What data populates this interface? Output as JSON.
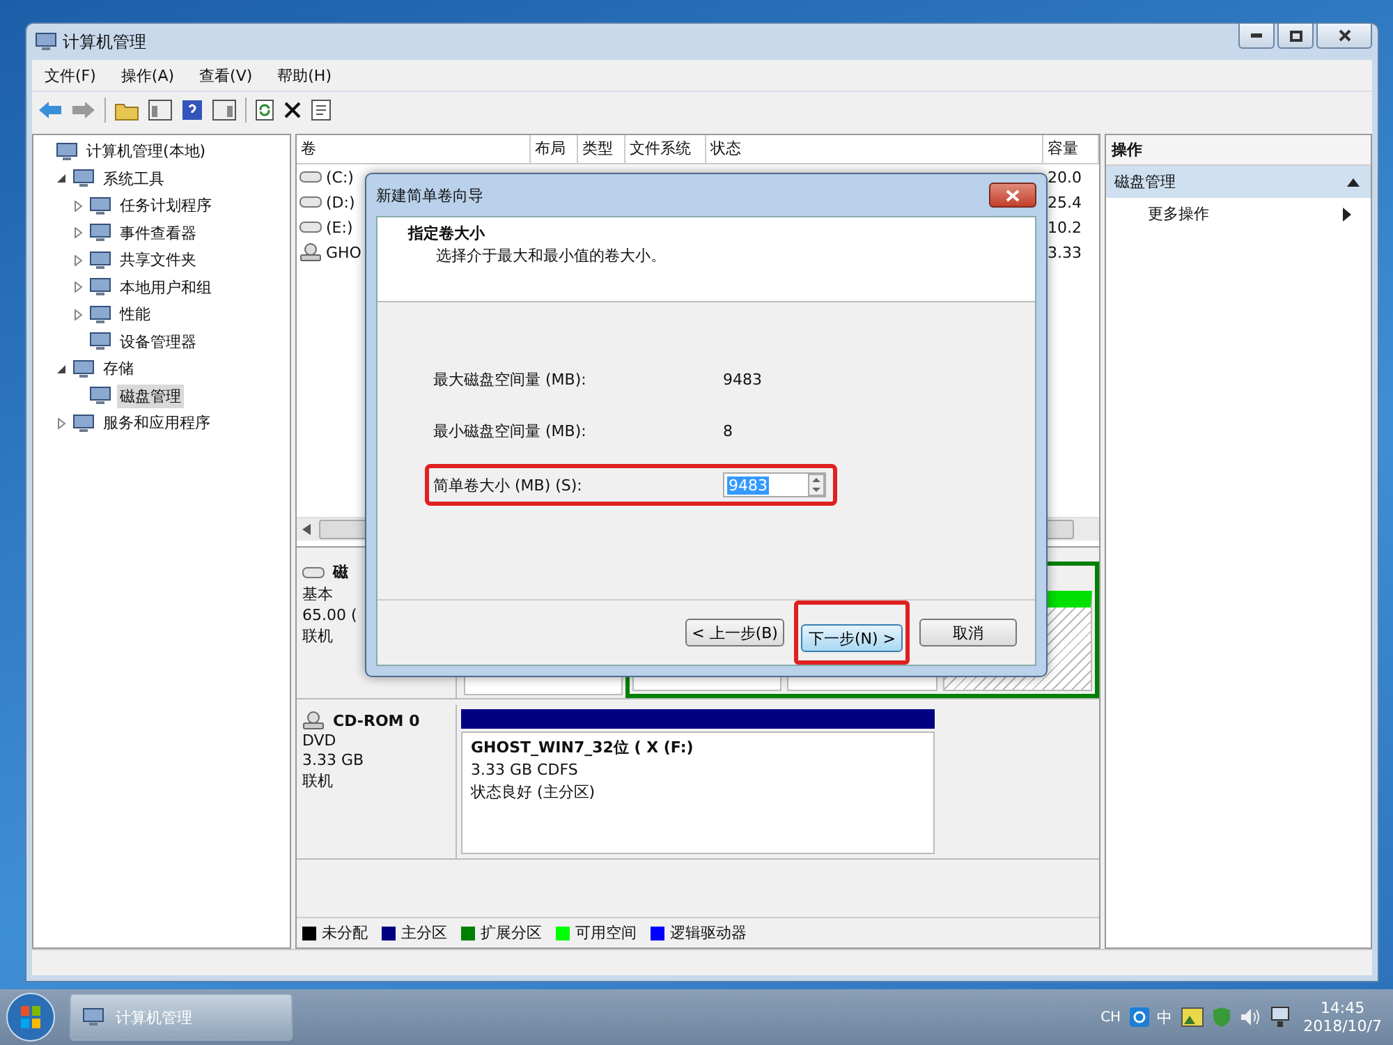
{
  "window": {
    "title": "计算机管理"
  },
  "menu": [
    "文件(F)",
    "操作(A)",
    "查看(V)",
    "帮助(H)"
  ],
  "tree": [
    {
      "label": "计算机管理(本地)",
      "selected": false,
      "children": [
        {
          "label": "系统工具",
          "kind": "branch",
          "expanded": true,
          "selected": false,
          "children": [
            {
              "label": "任务计划程序",
              "kind": "branch",
              "expanded": false,
              "selected": false
            },
            {
              "label": "事件查看器",
              "kind": "branch",
              "expanded": false,
              "selected": false
            },
            {
              "label": "共享文件夹",
              "kind": "branch",
              "expanded": false,
              "selected": false
            },
            {
              "label": "本地用户和组",
              "kind": "branch",
              "expanded": false,
              "selected": false
            },
            {
              "label": "性能",
              "kind": "branch",
              "expanded": false,
              "selected": false
            },
            {
              "label": "设备管理器",
              "kind": "leaf",
              "selected": false
            }
          ]
        },
        {
          "label": "存储",
          "kind": "branch",
          "expanded": true,
          "selected": false,
          "children": [
            {
              "label": "磁盘管理",
              "kind": "leaf",
              "selected": true
            }
          ]
        },
        {
          "label": "服务和应用程序",
          "kind": "branch",
          "expanded": false,
          "selected": false
        }
      ]
    }
  ],
  "table": {
    "columns": [
      "卷",
      "布局",
      "类型",
      "文件系统",
      "状态",
      "容量"
    ],
    "rows": [
      {
        "volume": "(C:)",
        "kind": "disk",
        "capacity": "20.0"
      },
      {
        "volume": "(D:)",
        "kind": "disk",
        "capacity": "25.4"
      },
      {
        "volume": "(E:)",
        "kind": "disk",
        "capacity": "10.2"
      },
      {
        "volume": "GHO",
        "kind": "cd",
        "capacity": "3.33"
      }
    ]
  },
  "disks": [
    {
      "name": "磁",
      "kind": "disk",
      "lines": [
        "基本",
        "65.00 (",
        "联机"
      ]
    },
    {
      "name": "CD-ROM 0",
      "kind": "cd",
      "lines": [
        "DVD",
        "3.33 GB",
        "联机"
      ],
      "partition": {
        "title": "GHOST_WIN7_32位 ( X  (F:)",
        "lines": [
          "3.33 GB CDFS",
          "状态良好 (主分区)"
        ]
      }
    }
  ],
  "legend": [
    {
      "label": "未分配",
      "color": "#000000"
    },
    {
      "label": "主分区",
      "color": "#000080"
    },
    {
      "label": "扩展分区",
      "color": "#008000"
    },
    {
      "label": "可用空间",
      "color": "#00ff00"
    },
    {
      "label": "逻辑驱动器",
      "color": "#0000ff"
    }
  ],
  "actions": {
    "title": "操作",
    "section": "磁盘管理",
    "items": [
      "更多操作"
    ]
  },
  "dialog": {
    "title": "新建简单卷向导",
    "heading": "指定卷大小",
    "subheading": "选择介于最大和最小值的卷大小。",
    "fields": [
      {
        "label": "最大磁盘空间量 (MB):",
        "value": "9483",
        "kind": "text",
        "highlighted": false
      },
      {
        "label": "最小磁盘空间量 (MB):",
        "value": "8",
        "kind": "text",
        "highlighted": false
      },
      {
        "label": "简单卷大小 (MB) (S):",
        "value": "9483",
        "kind": "spin",
        "highlighted": true,
        "selected": true
      }
    ],
    "buttons": [
      {
        "label": "< 上一步(B)",
        "focused": false,
        "highlighted": false
      },
      {
        "label": "下一步(N) >",
        "focused": true,
        "highlighted": true
      },
      {
        "label": "取消",
        "focused": false,
        "highlighted": false
      }
    ]
  },
  "taskbar": {
    "buttons": [
      {
        "label": "计算机管理",
        "selected": true
      }
    ],
    "lang": "CH",
    "ime": "中",
    "time": "14:45",
    "date": "2018/10/7"
  }
}
